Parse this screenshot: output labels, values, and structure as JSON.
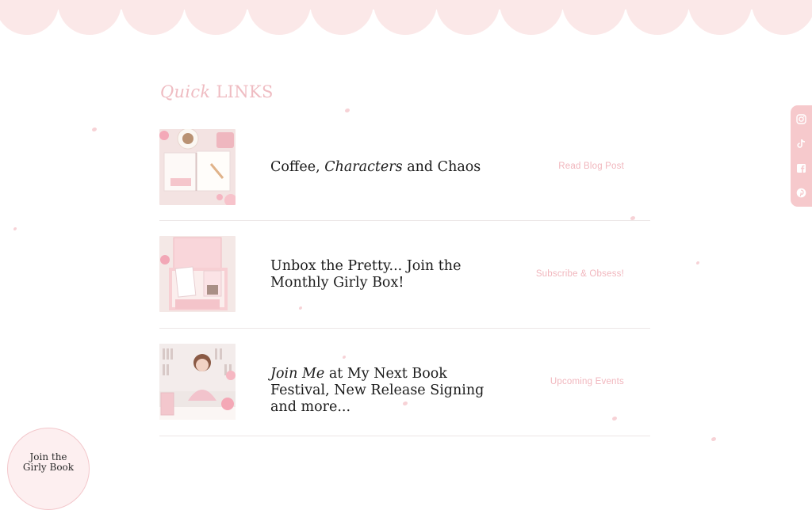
{
  "quick_links": {
    "title_script": "Quick",
    "title_rest": "LINKS",
    "items": [
      {
        "title_parts": [
          "Coffee, ",
          "Characters",
          " and Chaos"
        ],
        "cta": "Read Blog Post",
        "image": "desk-journal-coffee-image"
      },
      {
        "title": "Unbox the Pretty... Join the Monthly Girly Box!",
        "cta": "Subscribe & Obsess!",
        "image": "pink-subscription-box-image"
      },
      {
        "title_parts": [
          "Join Me",
          " at My Next Book Festival, New Release Signing and more..."
        ],
        "cta": "Upcoming Events",
        "image": "author-signing-books-image"
      }
    ]
  },
  "social": {
    "icons": [
      "instagram-icon",
      "tiktok-icon",
      "facebook-icon",
      "pinterest-icon"
    ]
  },
  "join_bubble": {
    "line1": "Join the",
    "line2": "Girly Book"
  },
  "colors": {
    "accent_pink": "#efbcc2",
    "scallop_pink": "#fbe8e8",
    "social_bar": "#f6c9cc"
  }
}
